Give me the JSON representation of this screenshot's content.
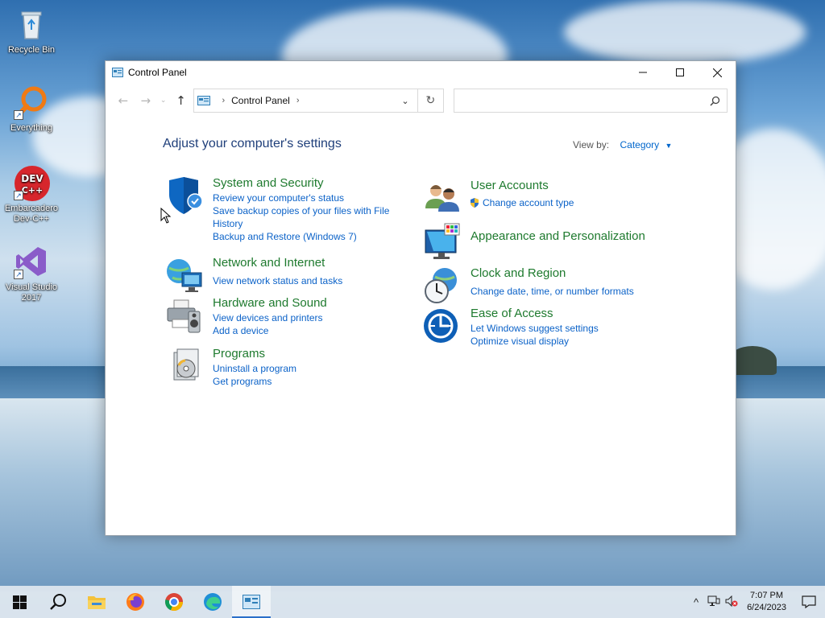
{
  "desktop": {
    "icons": [
      {
        "label": "Recycle Bin"
      },
      {
        "label": "Everything"
      },
      {
        "label": "Embarcadero Dev-C++"
      },
      {
        "label": "Visual Studio 2017"
      }
    ]
  },
  "window": {
    "title": "Control Panel",
    "controls": {
      "minimize": "—",
      "maximize": "☐",
      "close": "✕"
    },
    "address": {
      "crumb": "Control Panel",
      "separator": "›"
    },
    "search": {
      "placeholder": "",
      "value": ""
    },
    "heading": "Adjust your computer's settings",
    "view_by": {
      "label": "View by:",
      "value": "Category"
    },
    "left_categories": [
      {
        "title": "System and Security",
        "icon": "shield-icon",
        "links": [
          "Review your computer's status",
          "Save backup copies of your files with File History",
          "Backup and Restore (Windows 7)"
        ]
      },
      {
        "title": "Network and Internet",
        "icon": "network-globe-icon",
        "links": [
          "View network status and tasks"
        ]
      },
      {
        "title": "Hardware and Sound",
        "icon": "printer-speaker-icon",
        "links": [
          "View devices and printers",
          "Add a device"
        ]
      },
      {
        "title": "Programs",
        "icon": "programs-disk-icon",
        "links": [
          "Uninstall a program",
          "Get programs"
        ]
      }
    ],
    "right_categories": [
      {
        "title": "User Accounts",
        "icon": "users-icon",
        "links": [
          "Change account type"
        ]
      },
      {
        "title": "Appearance and Personalization",
        "icon": "monitor-palette-icon",
        "links": []
      },
      {
        "title": "Clock and Region",
        "icon": "clock-globe-icon",
        "links": [
          "Change date, time, or number formats"
        ]
      },
      {
        "title": "Ease of Access",
        "icon": "ease-of-access-icon",
        "links": [
          "Let Windows suggest settings",
          "Optimize visual display"
        ]
      }
    ]
  },
  "taskbar": {
    "apps": [
      "start",
      "search",
      "file-explorer",
      "firefox",
      "chrome",
      "edge",
      "control-panel"
    ],
    "clock": {
      "time": "7:07 PM",
      "date": "6/24/2023"
    }
  },
  "colors": {
    "link": "#0b62c8",
    "category_title": "#1e7a2e",
    "heading": "#1f3f7a",
    "accent": "#2a6fc9"
  }
}
